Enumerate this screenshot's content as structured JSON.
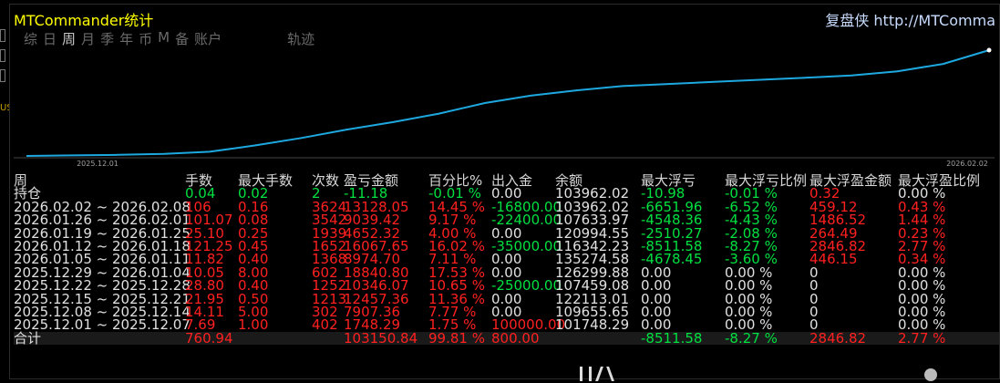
{
  "window": {
    "title": "MTCommander统计",
    "brand": "复盘侠 http://MTComma"
  },
  "tabs": [
    {
      "label": "综"
    },
    {
      "label": "日"
    },
    {
      "label": "周",
      "active": true
    },
    {
      "label": "月"
    },
    {
      "label": "季"
    },
    {
      "label": "年"
    },
    {
      "label": "币"
    },
    {
      "label": "M"
    },
    {
      "label": "备"
    },
    {
      "label": "账户"
    },
    {
      "label": "轨迹"
    }
  ],
  "chart_data": {
    "type": "line",
    "x_ticks": [
      "2025.12.01",
      "2026.02.02"
    ],
    "series": [
      {
        "color": "#1ea8e0",
        "values": [
          0,
          0.005,
          0.01,
          0.02,
          0.04,
          0.1,
          0.17,
          0.25,
          0.32,
          0.4,
          0.5,
          0.57,
          0.62,
          0.66,
          0.68,
          0.7,
          0.72,
          0.74,
          0.76,
          0.8,
          0.87,
          1.0
        ]
      }
    ]
  },
  "table": {
    "headers": [
      "周",
      "手数",
      "最大手数",
      "次数",
      "盈亏金额",
      "百分比%",
      "出入金",
      "余额",
      "最大浮亏",
      "最大浮亏比例",
      "最大浮盈金额",
      "最大浮盈比例"
    ],
    "rows": [
      {
        "week": "持仓",
        "lots": "0.04",
        "max_lots": "0.02",
        "count": "2",
        "pnl": "-11.18",
        "pct": "-0.01 %",
        "deposit": "0.00",
        "balance": "103962.02",
        "max_dd": "-10.98",
        "max_dd_pct": "-0.01 %",
        "max_fp": "0.32",
        "max_fp_pct": "0.00 %"
      },
      {
        "week": "2026.02.02 ~ 2026.02.08",
        "lots": "106",
        "max_lots": "0.16",
        "count": "3624",
        "pnl": "13128.05",
        "pct": "14.45 %",
        "deposit": "-16800.00",
        "balance": "103962.02",
        "max_dd": "-6651.96",
        "max_dd_pct": "-6.52 %",
        "max_fp": "459.12",
        "max_fp_pct": "0.43 %"
      },
      {
        "week": "2026.01.26 ~ 2026.02.01",
        "lots": "101.07",
        "max_lots": "0.08",
        "count": "3542",
        "pnl": "9039.42",
        "pct": "9.17 %",
        "deposit": "-22400.00",
        "balance": "107633.97",
        "max_dd": "-4548.36",
        "max_dd_pct": "-4.43 %",
        "max_fp": "1486.52",
        "max_fp_pct": "1.44 %"
      },
      {
        "week": "2026.01.19 ~ 2026.01.25",
        "lots": "25.10",
        "max_lots": "0.25",
        "count": "1939",
        "pnl": "4652.32",
        "pct": "4.00 %",
        "deposit": "0.00",
        "balance": "120994.55",
        "max_dd": "-2510.27",
        "max_dd_pct": "-2.08 %",
        "max_fp": "264.49",
        "max_fp_pct": "0.23 %"
      },
      {
        "week": "2026.01.12 ~ 2026.01.18",
        "lots": "121.25",
        "max_lots": "0.45",
        "count": "1652",
        "pnl": "16067.65",
        "pct": "16.02 %",
        "deposit": "-35000.00",
        "balance": "116342.23",
        "max_dd": "-8511.58",
        "max_dd_pct": "-8.27 %",
        "max_fp": "2846.82",
        "max_fp_pct": "2.77 %"
      },
      {
        "week": "2026.01.05 ~ 2026.01.11",
        "lots": "11.82",
        "max_lots": "0.40",
        "count": "1368",
        "pnl": "8974.70",
        "pct": "7.11 %",
        "deposit": "0.00",
        "balance": "135274.58",
        "max_dd": "-4678.45",
        "max_dd_pct": "-3.60 %",
        "max_fp": "446.15",
        "max_fp_pct": "0.34 %"
      },
      {
        "week": "2025.12.29 ~ 2026.01.04",
        "lots": "10.05",
        "max_lots": "8.00",
        "count": "602",
        "pnl": "18840.80",
        "pct": "17.53 %",
        "deposit": "0.00",
        "balance": "126299.88",
        "max_dd": "0.00",
        "max_dd_pct": "0.00 %",
        "max_fp": "0",
        "max_fp_pct": "0.00 %"
      },
      {
        "week": "2025.12.22 ~ 2025.12.28",
        "lots": "28.80",
        "max_lots": "0.40",
        "count": "1252",
        "pnl": "10346.07",
        "pct": "10.65 %",
        "deposit": "-25000.00",
        "balance": "107459.08",
        "max_dd": "0.00",
        "max_dd_pct": "0.00 %",
        "max_fp": "0",
        "max_fp_pct": "0.00 %"
      },
      {
        "week": "2025.12.15 ~ 2025.12.21",
        "lots": "21.95",
        "max_lots": "0.50",
        "count": "1213",
        "pnl": "12457.36",
        "pct": "11.36 %",
        "deposit": "0.00",
        "balance": "122113.01",
        "max_dd": "0.00",
        "max_dd_pct": "0.00 %",
        "max_fp": "0",
        "max_fp_pct": "0.00 %"
      },
      {
        "week": "2025.12.08 ~ 2025.12.14",
        "lots": "14.11",
        "max_lots": "5.00",
        "count": "302",
        "pnl": "7907.36",
        "pct": "7.77 %",
        "deposit": "0.00",
        "balance": "109655.65",
        "max_dd": "0.00",
        "max_dd_pct": "0.00 %",
        "max_fp": "0",
        "max_fp_pct": "0.00 %"
      },
      {
        "week": "2025.12.01 ~ 2025.12.07",
        "lots": "7.69",
        "max_lots": "1.00",
        "count": "402",
        "pnl": "1748.29",
        "pct": "1.75 %",
        "deposit": "100000.00",
        "balance": "101748.29",
        "max_dd": "0.00",
        "max_dd_pct": "0.00 %",
        "max_fp": "0",
        "max_fp_pct": "0.00 %"
      }
    ],
    "total": {
      "week": "合计",
      "lots": "760.94",
      "max_lots": "",
      "count": "",
      "pnl": "103150.84",
      "pct": "99.81 %",
      "deposit": "800.00",
      "balance": "",
      "max_dd": "-8511.58",
      "max_dd_pct": "-8.27 %",
      "max_fp": "2846.82",
      "max_fp_pct": "2.77 %"
    }
  },
  "colors": {
    "title": "#ffff00",
    "positive": "#ff2020",
    "negative": "#00e040",
    "neutral": "#e0e0e0",
    "line": "#1ea8e0"
  },
  "side_label": "USD"
}
